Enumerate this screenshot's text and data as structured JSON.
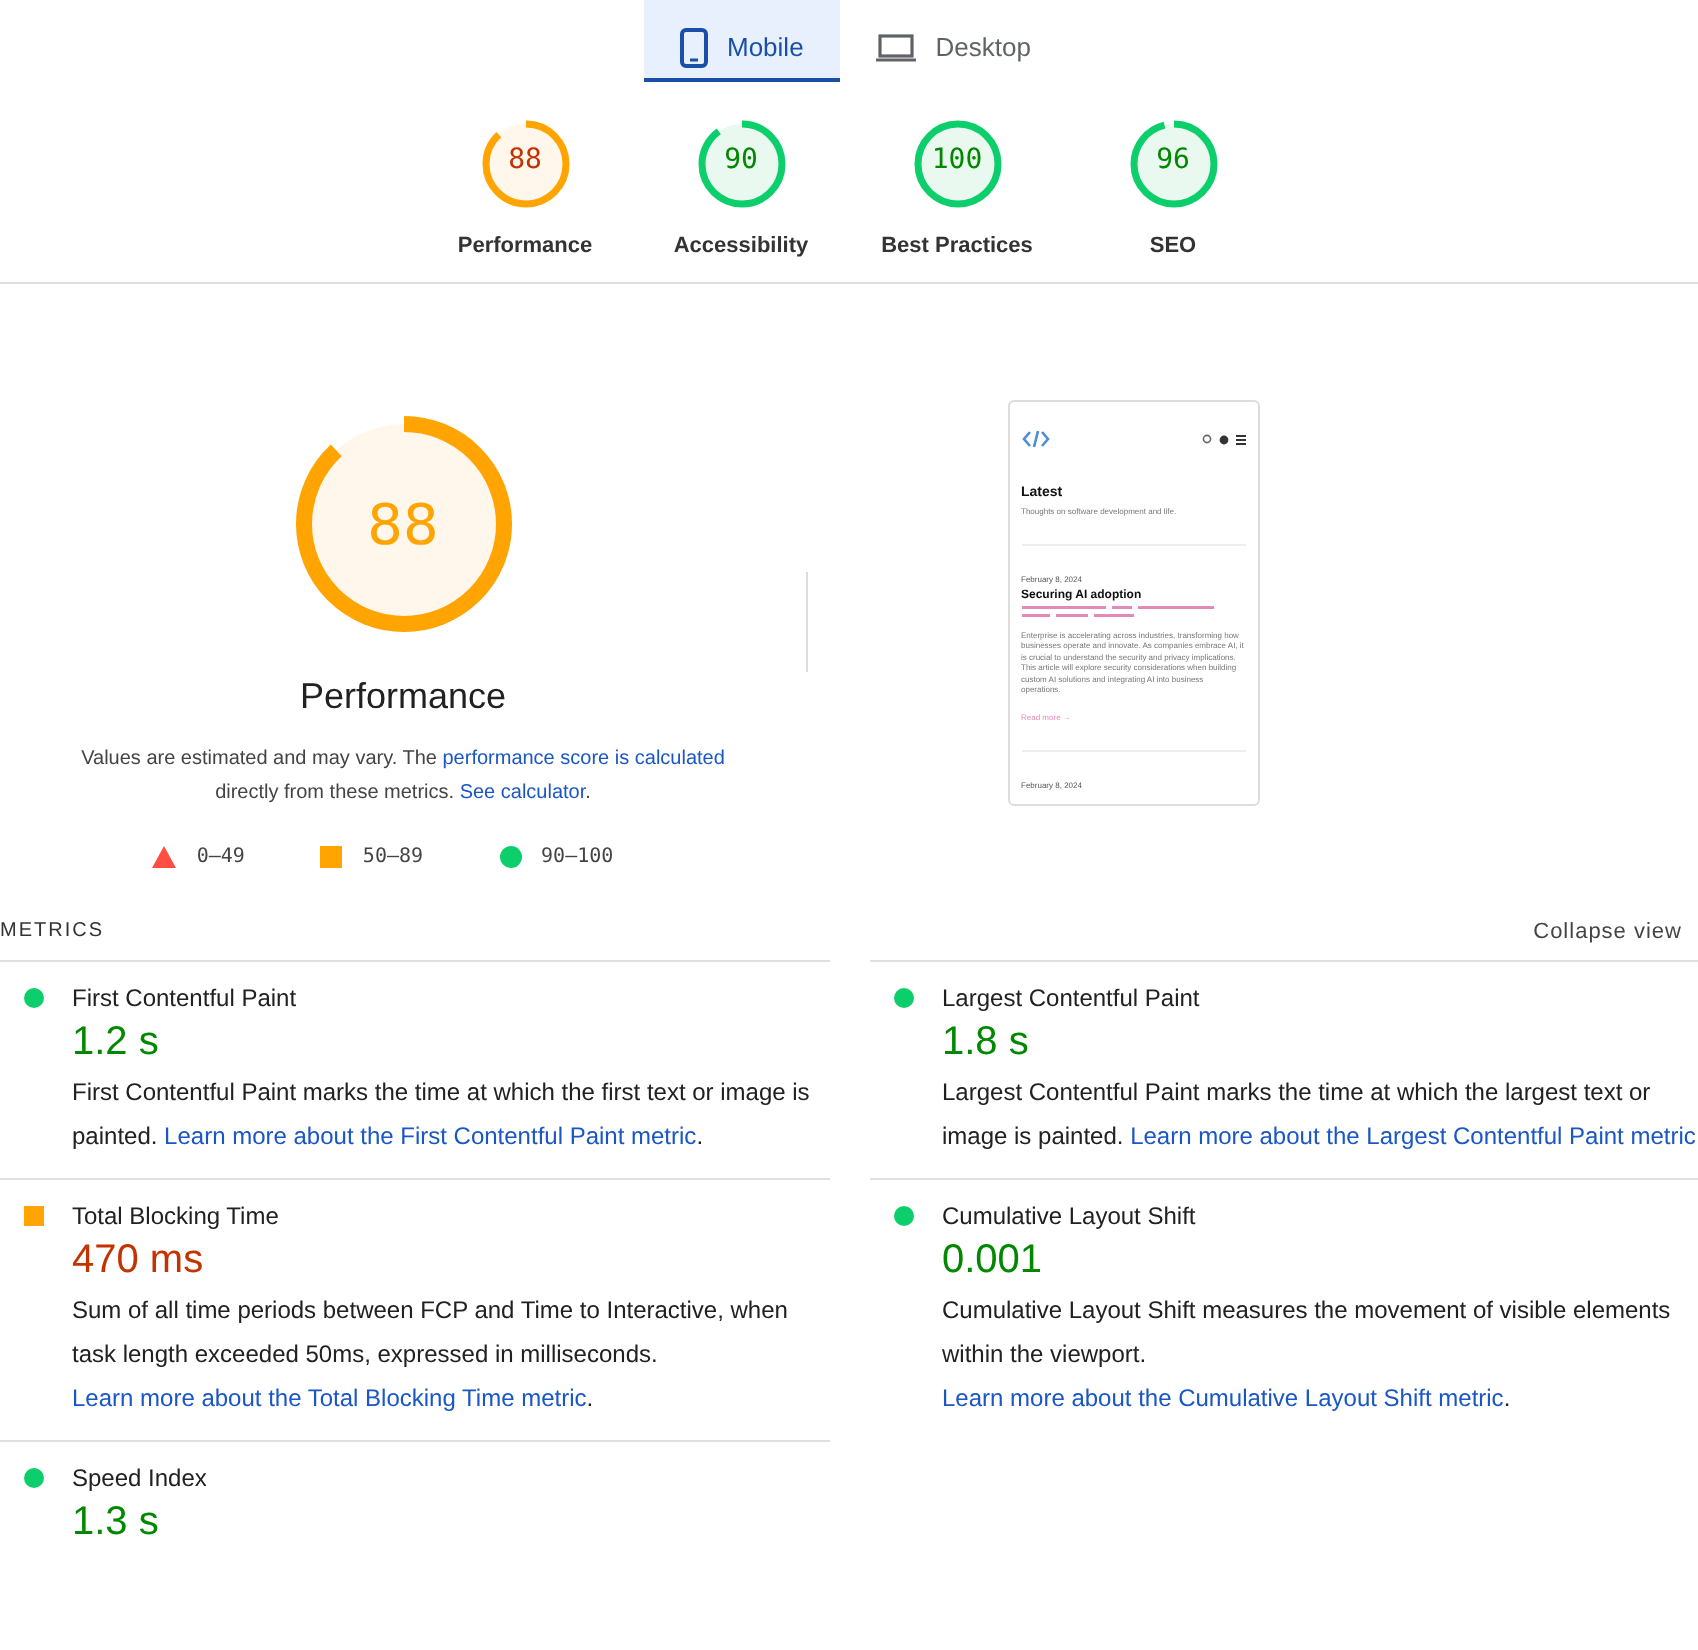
{
  "device_tabs": [
    {
      "label": "Mobile",
      "kind": "mobile",
      "selected": true
    },
    {
      "label": "Desktop",
      "kind": "desktop",
      "selected": false
    }
  ],
  "category_scores": [
    {
      "score": "88",
      "label": "Performance",
      "kind": "average",
      "level": 0.88
    },
    {
      "score": "90",
      "label": "Accessibility",
      "kind": "pass",
      "level": 0.9
    },
    {
      "score": "100",
      "label": "Best Practices",
      "kind": "pass",
      "level": 1
    },
    {
      "score": "96",
      "label": "SEO",
      "kind": "pass",
      "level": 0.96
    }
  ],
  "performance": {
    "score": "88",
    "kind": "average",
    "level": 0.88,
    "title": "Performance",
    "note": {
      "before": "Values are estimated and may vary. The ",
      "link_1": "performance score is calculated",
      "middle": " directly from these metrics. ",
      "link_2": "See calculator",
      "after": "."
    },
    "legend": [
      {
        "kind": "fail",
        "range": "0–49"
      },
      {
        "kind": "average",
        "range": "50–89"
      },
      {
        "kind": "pass",
        "range": "90–100"
      }
    ]
  },
  "screenshot": {
    "heading": "Latest",
    "tagline": "Thoughts on software development and life.",
    "post_date": "February 8, 2024",
    "post_title": "Securing AI adoption",
    "post_excerpt": "Enterprise is accelerating across industries, transforming how businesses operate and innovate. As companies embrace AI, it is crucial to understand the security and privacy implications. This article will explore security considerations when building custom AI solutions and integrating AI into business operations.",
    "read_more": "Read more →",
    "next_date": "February 8, 2024"
  },
  "metrics": {
    "title": "METRICS",
    "toggle": "Collapse view",
    "items": [
      {
        "name": "First Contentful Paint",
        "value": "1.2 s",
        "kind": "pass",
        "text": "First Contentful Paint marks the time at which the first text or image is painted. ",
        "link": "Learn more about the First Contentful Paint metric",
        "after": "."
      },
      {
        "name": "Largest Contentful Paint",
        "value": "1.8 s",
        "kind": "pass",
        "text": "Largest Contentful Paint marks the time at which the largest text or image is painted. ",
        "link": "Learn more about the Largest Contentful Paint metric"
      },
      {
        "name": "Total Blocking Time",
        "value": "470 ms",
        "kind": "average",
        "text": "Sum of all time periods between FCP and Time to Interactive, when task length exceeded 50ms, expressed in milliseconds. ",
        "link": "Learn more about the Total Blocking Time metric",
        "after": "."
      },
      {
        "name": "Cumulative Layout Shift",
        "value": "0.001",
        "kind": "pass",
        "text": "Cumulative Layout Shift measures the movement of visible elements within the viewport. ",
        "link": "Learn more about the Cumulative Layout Shift metric",
        "after": "."
      },
      {
        "name": "Speed Index",
        "value": "1.3 s",
        "kind": "pass"
      }
    ]
  }
}
